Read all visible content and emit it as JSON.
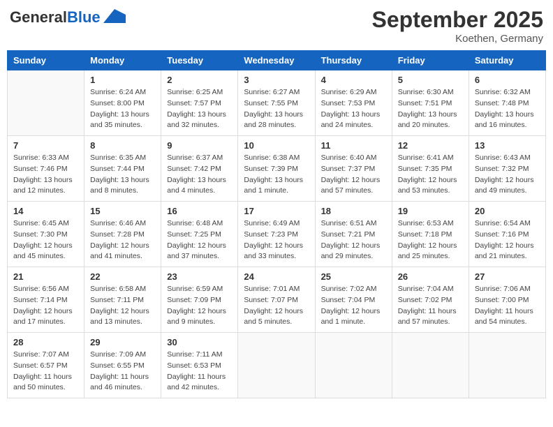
{
  "header": {
    "logo_line1": "General",
    "logo_line2": "Blue",
    "month": "September 2025",
    "location": "Koethen, Germany"
  },
  "weekdays": [
    "Sunday",
    "Monday",
    "Tuesday",
    "Wednesday",
    "Thursday",
    "Friday",
    "Saturday"
  ],
  "weeks": [
    [
      {
        "day": "",
        "info": ""
      },
      {
        "day": "1",
        "info": "Sunrise: 6:24 AM\nSunset: 8:00 PM\nDaylight: 13 hours\nand 35 minutes."
      },
      {
        "day": "2",
        "info": "Sunrise: 6:25 AM\nSunset: 7:57 PM\nDaylight: 13 hours\nand 32 minutes."
      },
      {
        "day": "3",
        "info": "Sunrise: 6:27 AM\nSunset: 7:55 PM\nDaylight: 13 hours\nand 28 minutes."
      },
      {
        "day": "4",
        "info": "Sunrise: 6:29 AM\nSunset: 7:53 PM\nDaylight: 13 hours\nand 24 minutes."
      },
      {
        "day": "5",
        "info": "Sunrise: 6:30 AM\nSunset: 7:51 PM\nDaylight: 13 hours\nand 20 minutes."
      },
      {
        "day": "6",
        "info": "Sunrise: 6:32 AM\nSunset: 7:48 PM\nDaylight: 13 hours\nand 16 minutes."
      }
    ],
    [
      {
        "day": "7",
        "info": "Sunrise: 6:33 AM\nSunset: 7:46 PM\nDaylight: 13 hours\nand 12 minutes."
      },
      {
        "day": "8",
        "info": "Sunrise: 6:35 AM\nSunset: 7:44 PM\nDaylight: 13 hours\nand 8 minutes."
      },
      {
        "day": "9",
        "info": "Sunrise: 6:37 AM\nSunset: 7:42 PM\nDaylight: 13 hours\nand 4 minutes."
      },
      {
        "day": "10",
        "info": "Sunrise: 6:38 AM\nSunset: 7:39 PM\nDaylight: 13 hours\nand 1 minute."
      },
      {
        "day": "11",
        "info": "Sunrise: 6:40 AM\nSunset: 7:37 PM\nDaylight: 12 hours\nand 57 minutes."
      },
      {
        "day": "12",
        "info": "Sunrise: 6:41 AM\nSunset: 7:35 PM\nDaylight: 12 hours\nand 53 minutes."
      },
      {
        "day": "13",
        "info": "Sunrise: 6:43 AM\nSunset: 7:32 PM\nDaylight: 12 hours\nand 49 minutes."
      }
    ],
    [
      {
        "day": "14",
        "info": "Sunrise: 6:45 AM\nSunset: 7:30 PM\nDaylight: 12 hours\nand 45 minutes."
      },
      {
        "day": "15",
        "info": "Sunrise: 6:46 AM\nSunset: 7:28 PM\nDaylight: 12 hours\nand 41 minutes."
      },
      {
        "day": "16",
        "info": "Sunrise: 6:48 AM\nSunset: 7:25 PM\nDaylight: 12 hours\nand 37 minutes."
      },
      {
        "day": "17",
        "info": "Sunrise: 6:49 AM\nSunset: 7:23 PM\nDaylight: 12 hours\nand 33 minutes."
      },
      {
        "day": "18",
        "info": "Sunrise: 6:51 AM\nSunset: 7:21 PM\nDaylight: 12 hours\nand 29 minutes."
      },
      {
        "day": "19",
        "info": "Sunrise: 6:53 AM\nSunset: 7:18 PM\nDaylight: 12 hours\nand 25 minutes."
      },
      {
        "day": "20",
        "info": "Sunrise: 6:54 AM\nSunset: 7:16 PM\nDaylight: 12 hours\nand 21 minutes."
      }
    ],
    [
      {
        "day": "21",
        "info": "Sunrise: 6:56 AM\nSunset: 7:14 PM\nDaylight: 12 hours\nand 17 minutes."
      },
      {
        "day": "22",
        "info": "Sunrise: 6:58 AM\nSunset: 7:11 PM\nDaylight: 12 hours\nand 13 minutes."
      },
      {
        "day": "23",
        "info": "Sunrise: 6:59 AM\nSunset: 7:09 PM\nDaylight: 12 hours\nand 9 minutes."
      },
      {
        "day": "24",
        "info": "Sunrise: 7:01 AM\nSunset: 7:07 PM\nDaylight: 12 hours\nand 5 minutes."
      },
      {
        "day": "25",
        "info": "Sunrise: 7:02 AM\nSunset: 7:04 PM\nDaylight: 12 hours\nand 1 minute."
      },
      {
        "day": "26",
        "info": "Sunrise: 7:04 AM\nSunset: 7:02 PM\nDaylight: 11 hours\nand 57 minutes."
      },
      {
        "day": "27",
        "info": "Sunrise: 7:06 AM\nSunset: 7:00 PM\nDaylight: 11 hours\nand 54 minutes."
      }
    ],
    [
      {
        "day": "28",
        "info": "Sunrise: 7:07 AM\nSunset: 6:57 PM\nDaylight: 11 hours\nand 50 minutes."
      },
      {
        "day": "29",
        "info": "Sunrise: 7:09 AM\nSunset: 6:55 PM\nDaylight: 11 hours\nand 46 minutes."
      },
      {
        "day": "30",
        "info": "Sunrise: 7:11 AM\nSunset: 6:53 PM\nDaylight: 11 hours\nand 42 minutes."
      },
      {
        "day": "",
        "info": ""
      },
      {
        "day": "",
        "info": ""
      },
      {
        "day": "",
        "info": ""
      },
      {
        "day": "",
        "info": ""
      }
    ]
  ]
}
